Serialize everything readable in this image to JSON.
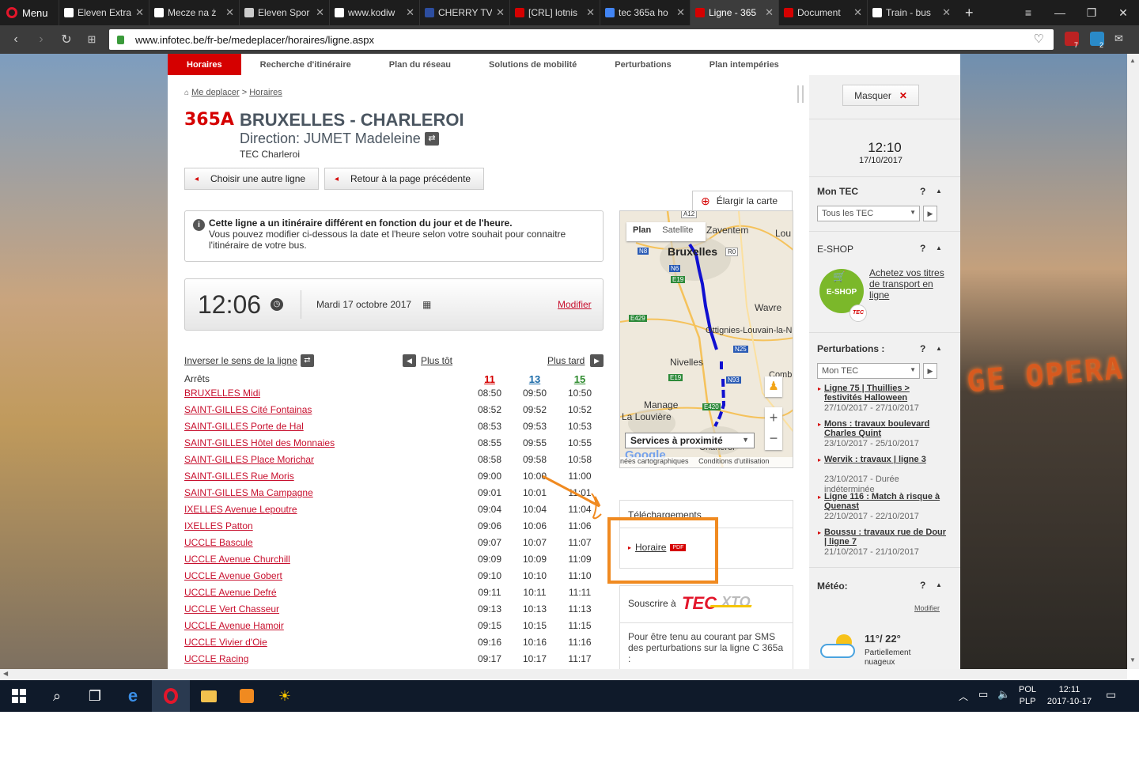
{
  "browser": {
    "menu_label": "Menu",
    "tabs": [
      {
        "title": "Eleven Extra",
        "color": "#ffffff"
      },
      {
        "title": "Mecze na ż",
        "color": "#ffffff"
      },
      {
        "title": "Eleven Spor",
        "color": "#cccccc"
      },
      {
        "title": "www.kodiw",
        "color": "#ffffff"
      },
      {
        "title": "CHERRY TV",
        "color": "#2d4ea0"
      },
      {
        "title": "[CRL] lotnis",
        "color": "#d50000"
      },
      {
        "title": "tec 365a ho",
        "color": "#4285f4"
      },
      {
        "title": "Ligne - 365",
        "color": "#d50000"
      },
      {
        "title": "Document",
        "color": "#d50000"
      },
      {
        "title": "Train - bus",
        "color": "#ffffff"
      }
    ],
    "url": "www.infotec.be/fr-be/medeplacer/horaires/ligne.aspx",
    "ext_badges": [
      "7",
      "2"
    ]
  },
  "nav": {
    "items": [
      "Horaires",
      "Recherche d'itinéraire",
      "Plan du réseau",
      "Solutions de mobilité",
      "Perturbations",
      "Plan intempéries"
    ]
  },
  "breadcrumb": {
    "home": "Me deplacer",
    "sep": ">",
    "current": "Horaires"
  },
  "line": {
    "number": "365A",
    "title": "BRUXELLES - CHARLEROI",
    "direction": "Direction: JUMET Madeleine",
    "operator": "TEC Charleroi"
  },
  "buttons": {
    "other_line": "Choisir une autre ligne",
    "back": "Retour à la page précédente",
    "enlarge_map": "Élargir la carte"
  },
  "info": {
    "bold": "Cette ligne a un itinéraire différent en fonction du jour et de l'heure.",
    "text": "Vous pouvez modifier ci-dessous la date et l'heure selon votre souhait pour connaitre l'itinéraire de votre bus."
  },
  "time": {
    "value": "12:06",
    "date": "Mardi 17 octobre 2017",
    "modify": "Modifier"
  },
  "controls": {
    "reverse": "Inverser le sens de la ligne",
    "earlier": "Plus tôt",
    "later": "Plus tard"
  },
  "table": {
    "stops_label": "Arrêts",
    "columns": [
      {
        "label": "11",
        "color": "#d50000"
      },
      {
        "label": "13",
        "color": "#1a6aa8"
      },
      {
        "label": "15",
        "color": "#2e8b2e"
      }
    ],
    "rows": [
      {
        "stop": "BRUXELLES Midi",
        "t": [
          "08:50",
          "09:50",
          "10:50"
        ]
      },
      {
        "stop": "SAINT-GILLES Cité Fontainas",
        "t": [
          "08:52",
          "09:52",
          "10:52"
        ]
      },
      {
        "stop": "SAINT-GILLES Porte de Hal",
        "t": [
          "08:53",
          "09:53",
          "10:53"
        ]
      },
      {
        "stop": "SAINT-GILLES Hôtel des Monnaies",
        "t": [
          "08:55",
          "09:55",
          "10:55"
        ]
      },
      {
        "stop": "SAINT-GILLES Place Morichar",
        "t": [
          "08:58",
          "09:58",
          "10:58"
        ]
      },
      {
        "stop": "SAINT-GILLES Rue Moris",
        "t": [
          "09:00",
          "10:00",
          "11:00"
        ]
      },
      {
        "stop": "SAINT-GILLES Ma Campagne",
        "t": [
          "09:01",
          "10:01",
          "11:01"
        ]
      },
      {
        "stop": "IXELLES Avenue Lepoutre",
        "t": [
          "09:04",
          "10:04",
          "11:04"
        ]
      },
      {
        "stop": "IXELLES Patton",
        "t": [
          "09:06",
          "10:06",
          "11:06"
        ]
      },
      {
        "stop": "UCCLE Bascule",
        "t": [
          "09:07",
          "10:07",
          "11:07"
        ]
      },
      {
        "stop": "UCCLE Avenue Churchill",
        "t": [
          "09:09",
          "10:09",
          "11:09"
        ]
      },
      {
        "stop": "UCCLE Avenue Gobert",
        "t": [
          "09:10",
          "10:10",
          "11:10"
        ]
      },
      {
        "stop": "UCCLE Avenue Defré",
        "t": [
          "09:11",
          "10:11",
          "11:11"
        ]
      },
      {
        "stop": "UCCLE Vert Chasseur",
        "t": [
          "09:13",
          "10:13",
          "11:13"
        ]
      },
      {
        "stop": "UCCLE Avenue Hamoir",
        "t": [
          "09:15",
          "10:15",
          "11:15"
        ]
      },
      {
        "stop": "UCCLE Vivier d'Oie",
        "t": [
          "09:16",
          "10:16",
          "11:16"
        ]
      },
      {
        "stop": "UCCLE Racing",
        "t": [
          "09:17",
          "10:17",
          "11:17"
        ]
      }
    ]
  },
  "map": {
    "tab_plan": "Plan",
    "tab_satellite": "Satellite",
    "places": [
      "Bruxelles",
      "Zaventem",
      "Lou",
      "Wavre",
      "Ottignies-Louvain-la-N",
      "Nivelles",
      "Manage",
      "La Louvière",
      "Comb",
      "Charleroi"
    ],
    "roads": [
      "A12",
      "N8",
      "R0",
      "N6",
      "E19",
      "E429",
      "N25",
      "N93",
      "E19",
      "E420"
    ],
    "services": "Services à proximité",
    "footer_data": "nées cartographiques",
    "footer_terms": "Conditions d'utilisation",
    "google": "Google"
  },
  "downloads": {
    "title": "Téléchargements",
    "link": "Horaire",
    "pdf": "PDF"
  },
  "subscribe": {
    "label": "Souscrire à",
    "brand": "TEC",
    "brand2": "XTO",
    "text": "Pour être tenu au courant par SMS des perturbations sur la ligne C 365a :"
  },
  "sidebar": {
    "hide": "Masquer",
    "clock": "12:10",
    "date": "17/10/2017",
    "montec": {
      "title": "Mon TEC",
      "select": "Tous les TEC"
    },
    "eshop": {
      "title": "E-SHOP",
      "badge": "E-SHOP",
      "tec": "TEC",
      "link": "Achetez vos titres de transport en ligne"
    },
    "perturbations": {
      "title": "Perturbations :",
      "select": "Mon TEC",
      "items": [
        {
          "title": "Ligne 75 | Thuillies > festivités Halloween",
          "date": "27/10/2017 - 27/10/2017"
        },
        {
          "title": "Mons : travaux boulevard Charles Quint",
          "date": "23/10/2017 - 25/10/2017"
        },
        {
          "title": "Wervik : travaux | ligne 3",
          "date": "23/10/2017 - Durée indéterminée"
        },
        {
          "title": "Ligne 116 : Match à risque à Quenast",
          "date": "22/10/2017 - 22/10/2017"
        },
        {
          "title": "Boussu : travaux rue de Dour | ligne 7",
          "date": "21/10/2017 - 21/10/2017"
        }
      ]
    },
    "meteo": {
      "title": "Météo:",
      "modify": "Modifier",
      "temp": "11°/ 22°",
      "desc": "Partiellement nuageux"
    },
    "help": "?"
  },
  "background_sign": "GE OPERA",
  "taskbar": {
    "lang1": "POL",
    "lang2": "PLP",
    "time": "12:11",
    "date": "2017-10-17"
  }
}
